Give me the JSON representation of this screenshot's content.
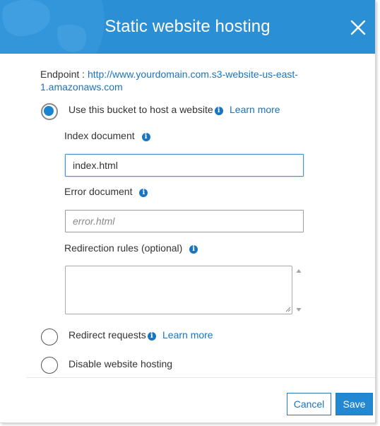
{
  "dialog": {
    "title": "Static website hosting",
    "close_icon": "close-icon",
    "header_color": "#2b8fd6"
  },
  "endpoint": {
    "label": "Endpoint :",
    "url_line1": "http://www.yourdomain.com.s3-website-us-east-",
    "url_line2": "1.amazonaws.com"
  },
  "options": {
    "host": {
      "label": "Use this bucket to host a website",
      "learn_more": "Learn more",
      "selected": true
    },
    "redirect": {
      "label": "Redirect requests",
      "learn_more": "Learn more",
      "selected": false
    },
    "disable": {
      "label": "Disable website hosting",
      "selected": false
    }
  },
  "fields": {
    "index": {
      "label": "Index document",
      "value": "index.html",
      "placeholder": ""
    },
    "error": {
      "label": "Error document",
      "value": "",
      "placeholder": "error.html"
    },
    "redirection": {
      "label": "Redirection rules (optional)",
      "value": ""
    }
  },
  "info_icon_glyph": "i",
  "footer": {
    "cancel_label": "Cancel",
    "save_label": "Save"
  },
  "colors": {
    "accent": "#2188d1",
    "link": "#1a74c0"
  }
}
